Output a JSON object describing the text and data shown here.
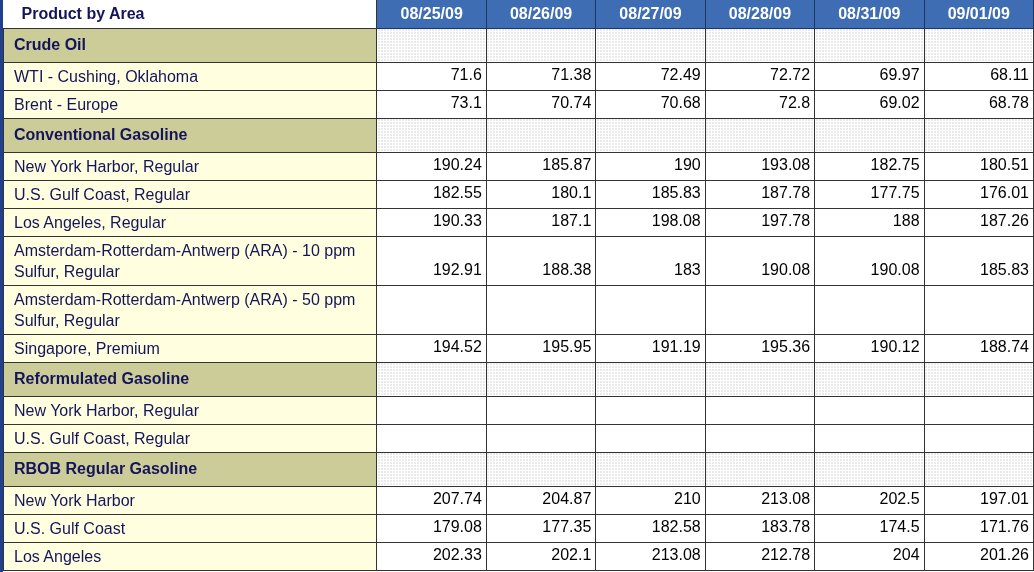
{
  "table": {
    "columns": [
      "Product by Area",
      "08/25/09",
      "08/26/09",
      "08/27/09",
      "08/28/09",
      "08/31/09",
      "09/01/09"
    ],
    "rows": [
      {
        "kind": "section",
        "label": "Crude Oil"
      },
      {
        "kind": "item",
        "label": "WTI - Cushing, Oklahoma",
        "values": [
          "71.6",
          "71.38",
          "72.49",
          "72.72",
          "69.97",
          "68.11"
        ]
      },
      {
        "kind": "item",
        "label": "Brent - Europe",
        "values": [
          "73.1",
          "70.74",
          "70.68",
          "72.8",
          "69.02",
          "68.78"
        ]
      },
      {
        "kind": "section",
        "label": "Conventional Gasoline"
      },
      {
        "kind": "item",
        "label": "New York Harbor, Regular",
        "values": [
          "190.24",
          "185.87",
          "190",
          "193.08",
          "182.75",
          "180.51"
        ]
      },
      {
        "kind": "item",
        "label": "U.S. Gulf Coast, Regular",
        "values": [
          "182.55",
          "180.1",
          "185.83",
          "187.78",
          "177.75",
          "176.01"
        ]
      },
      {
        "kind": "item",
        "label": "Los Angeles, Regular",
        "values": [
          "190.33",
          "187.1",
          "198.08",
          "197.78",
          "188",
          "187.26"
        ]
      },
      {
        "kind": "item",
        "label": "Amsterdam-Rotterdam-Antwerp (ARA) - 10 ppm Sulfur, Regular",
        "values": [
          "192.91",
          "188.38",
          "183",
          "190.08",
          "190.08",
          "185.83"
        ]
      },
      {
        "kind": "item",
        "label": "Amsterdam-Rotterdam-Antwerp (ARA) - 50 ppm Sulfur, Regular"
      },
      {
        "kind": "item",
        "label": "Singapore, Premium",
        "values": [
          "194.52",
          "195.95",
          "191.19",
          "195.36",
          "190.12",
          "188.74"
        ]
      },
      {
        "kind": "section",
        "label": "Reformulated Gasoline"
      },
      {
        "kind": "item",
        "label": "New York Harbor, Regular"
      },
      {
        "kind": "item",
        "label": "U.S. Gulf Coast, Regular"
      },
      {
        "kind": "section",
        "label": "RBOB Regular Gasoline"
      },
      {
        "kind": "item",
        "label": "New York Harbor",
        "values": [
          "207.74",
          "204.87",
          "210",
          "213.08",
          "202.5",
          "197.01"
        ]
      },
      {
        "kind": "item",
        "label": "U.S. Gulf Coast",
        "values": [
          "179.08",
          "177.35",
          "182.58",
          "183.78",
          "174.5",
          "171.76"
        ]
      },
      {
        "kind": "item",
        "label": "Los Angeles",
        "values": [
          "202.33",
          "202.1",
          "213.08",
          "212.78",
          "204",
          "201.26"
        ]
      }
    ]
  }
}
